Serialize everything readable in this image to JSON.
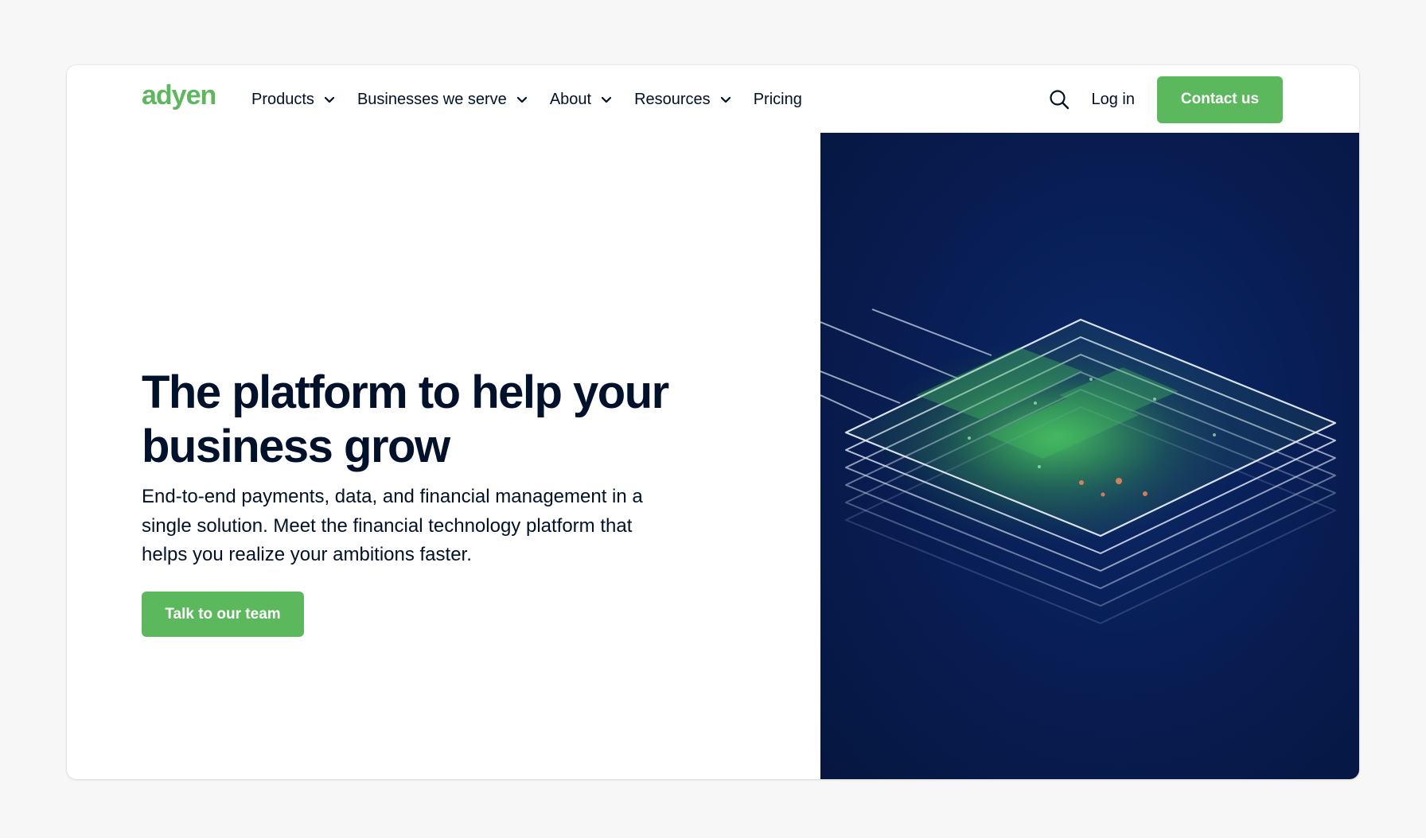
{
  "brand": {
    "logo_text": "adyen",
    "accent_color": "#5cb85c",
    "text_color": "#00112c"
  },
  "nav": {
    "items": [
      {
        "label": "Products",
        "has_dropdown": true
      },
      {
        "label": "Businesses we serve",
        "has_dropdown": true
      },
      {
        "label": "About",
        "has_dropdown": true
      },
      {
        "label": "Resources",
        "has_dropdown": true
      },
      {
        "label": "Pricing",
        "has_dropdown": false
      }
    ],
    "search_icon": "search-icon",
    "login_label": "Log in",
    "contact_label": "Contact us"
  },
  "hero": {
    "headline": "The platform to help your business grow",
    "subtext": "End-to-end payments, data, and financial management in a single solution. Meet the financial technology platform that helps you realize your ambitions faster.",
    "cta_label": "Talk to our team",
    "visual_background": "#081e55"
  }
}
